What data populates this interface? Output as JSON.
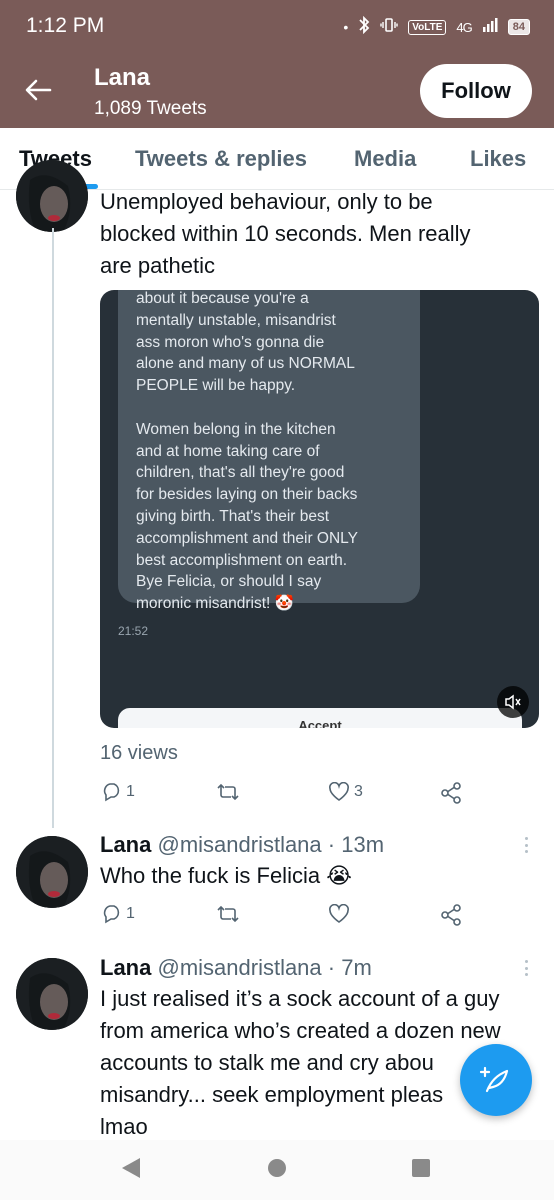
{
  "status_bar": {
    "time": "1:12 PM",
    "dot": "•",
    "volte": "VoLTE",
    "network": "4G",
    "battery": "84"
  },
  "header": {
    "name": "Lana",
    "tweet_count": "1,089 Tweets",
    "follow_label": "Follow"
  },
  "tabs": [
    {
      "label": "Tweets",
      "active": true
    },
    {
      "label": "Tweets & replies",
      "active": false
    },
    {
      "label": "Media",
      "active": false
    },
    {
      "label": "Likes",
      "active": false
    }
  ],
  "tweet1": {
    "text_lines": [
      "Unemployed behaviour, only to be",
      "blocked within 10 seconds. Men really",
      "are pathetic"
    ],
    "media": {
      "message": "about it because you're a\nmentally unstable, misandrist\nass moron who's gonna die\nalone and many of us NORMAL\nPEOPLE will be happy.\n\nWomen belong in the kitchen\nand at home taking care of\nchildren, that's all they're good\nfor besides laying on their backs\ngiving birth. That's their best\naccomplishment and their ONLY\nbest accomplishment on earth.\nBye Felicia, or should I say\nmoronic misandrist! 🤡",
      "timestamp": "21:52",
      "accept_label": "Accept"
    },
    "views": "16 views",
    "reply_count": "1",
    "retweet_count": "",
    "like_count": "3"
  },
  "tweet2": {
    "name": "Lana",
    "handle": "@misandristlana",
    "sep": "·",
    "time": "13m",
    "text": "Who the fuck is Felicia 😭",
    "reply_count": "1",
    "retweet_count": "",
    "like_count": ""
  },
  "tweet3": {
    "name": "Lana",
    "handle": "@misandristlana",
    "sep": "·",
    "time": "7m",
    "text_lines": [
      "I just realised it’s a sock account of a guy",
      "from america who’s created a dozen new",
      "accounts to stalk me and cry abou",
      "misandry... seek employment pleas",
      "lmao"
    ]
  },
  "colors": {
    "banner": "#7a5b58",
    "accent": "#1d9bf0",
    "muted_text": "#536471"
  },
  "icons": [
    "back-arrow-icon",
    "reply-icon",
    "retweet-icon",
    "like-icon",
    "share-icon",
    "more-icon",
    "compose-icon",
    "mute-icon",
    "nav-back-icon",
    "nav-home-icon",
    "nav-recents-icon"
  ]
}
